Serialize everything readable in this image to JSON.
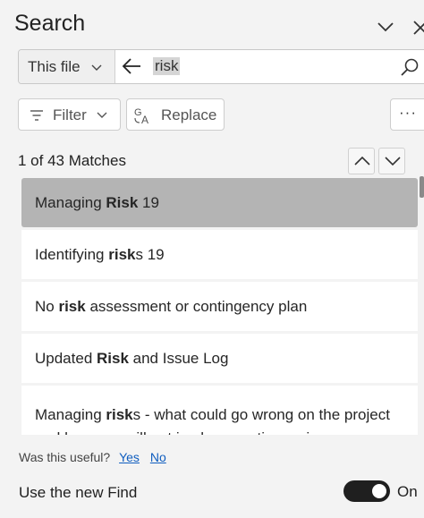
{
  "panel": {
    "title": "Search"
  },
  "search": {
    "scope": "This file",
    "query": "risk"
  },
  "toolbar": {
    "filter_label": "Filter",
    "replace_label": "Replace",
    "more_label": "···"
  },
  "status": {
    "matches": "1 of 43 Matches"
  },
  "results": [
    {
      "pre": "Managing ",
      "match": "Risk",
      "post": " 19",
      "selected": true
    },
    {
      "pre": "Identifying ",
      "match": "risk",
      "post": "s 19"
    },
    {
      "pre": "No ",
      "match": "risk",
      "post": " assessment or contingency plan"
    },
    {
      "pre": "Updated ",
      "match": "Risk",
      "post": " and Issue Log"
    },
    {
      "pre": "Managing ",
      "match": "risk",
      "post": "s - what could go wrong on the project and how you will put in place contingencies or"
    }
  ],
  "feedback": {
    "question": "Was this useful?",
    "yes": "Yes",
    "no": "No"
  },
  "new_find": {
    "label": "Use the new Find",
    "state": "On",
    "enabled": true
  },
  "icons": {
    "collapse": "chevron-down-icon",
    "close": "close-icon",
    "scope_dropdown": "chevron-down-icon",
    "back": "back-arrow-icon",
    "search": "search-icon",
    "filter": "filter-icon",
    "replace": "replace-icon",
    "prev": "chevron-up-icon",
    "next": "chevron-down-icon"
  },
  "colors": {
    "selected_result": "#b4b4b4",
    "link": "#0f5dbf",
    "toggle_on": "#1f1f1f"
  }
}
